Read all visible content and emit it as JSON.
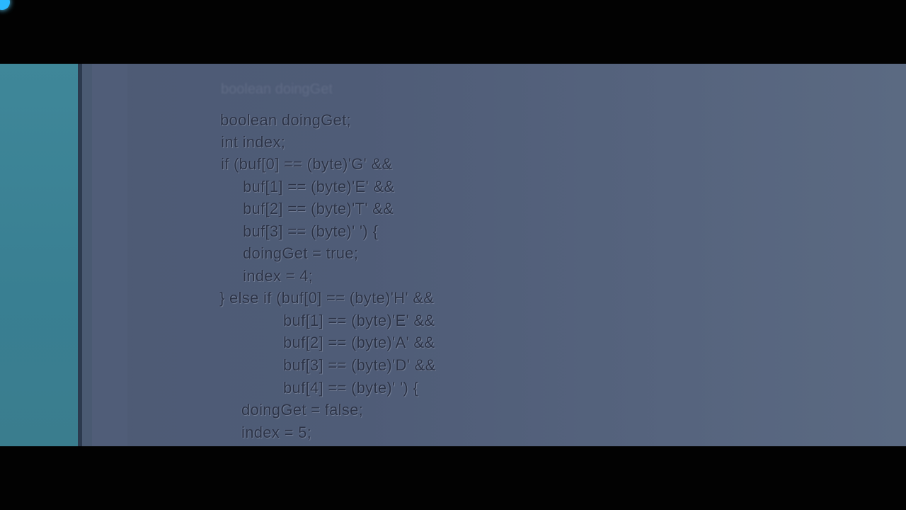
{
  "code_lines": [
    "boolean doingGet;",
    "int index;",
    "if (buf[0] == (byte)'G' &&",
    "buf[1] == (byte)'E' &&",
    "buf[2] == (byte)'T' &&",
    "buf[3] == (byte)' ') {",
    "doingGet = true;",
    "index = 4;",
    "} else if (buf[0] == (byte)'H' &&",
    "buf[1] == (byte)'E' &&",
    "buf[2] == (byte)'A' &&",
    "buf[3] == (byte)'D' &&",
    "buf[4] == (byte)' ') {",
    "doingGet = false;",
    "index = 5;"
  ],
  "ghost_text": "boolean doingGet",
  "colors": {
    "panel": "#3f8799",
    "screen": "#4f5c77",
    "text": "#2c3346"
  }
}
